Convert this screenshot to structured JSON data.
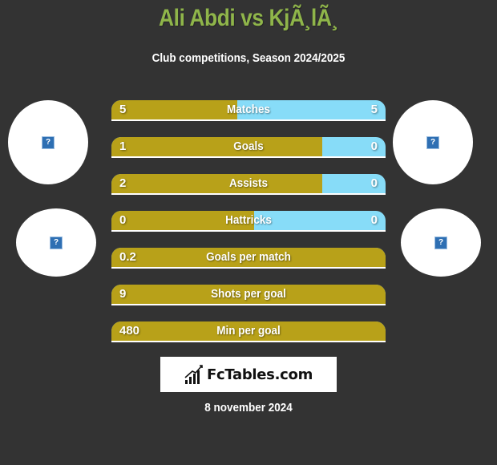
{
  "header": {
    "title": "Ali Abdi vs KjÃ¸lÃ¸",
    "subtitle": "Club competitions, Season 2024/2025"
  },
  "avatars": [
    {
      "name": "player1-photo",
      "icon": "missing-image-icon",
      "glyph": "?"
    },
    {
      "name": "player2-photo",
      "icon": "missing-image-icon",
      "glyph": "?"
    },
    {
      "name": "team1-logo",
      "icon": "missing-image-icon",
      "glyph": "?"
    },
    {
      "name": "team2-logo",
      "icon": "missing-image-icon",
      "glyph": "?"
    }
  ],
  "colors": {
    "left": "#b8a119",
    "right": "#87dcf8",
    "title": "#8fb54a",
    "background": "#333333"
  },
  "stats": [
    {
      "label": "Matches",
      "left": "5",
      "right": "5",
      "left_share": 0.46
    },
    {
      "label": "Goals",
      "left": "1",
      "right": "0",
      "left_share": 0.77
    },
    {
      "label": "Assists",
      "left": "2",
      "right": "0",
      "left_share": 0.77
    },
    {
      "label": "Hattricks",
      "left": "0",
      "right": "0",
      "left_share": 0.52
    },
    {
      "label": "Goals per match",
      "left": "0.2",
      "right": "",
      "left_share": 1.0
    },
    {
      "label": "Shots per goal",
      "left": "9",
      "right": "",
      "left_share": 1.0
    },
    {
      "label": "Min per goal",
      "left": "480",
      "right": "",
      "left_share": 1.0
    }
  ],
  "footer": {
    "brand": "FcTables.com",
    "brand_icon": "bar-chart-icon",
    "date": "8 november 2024"
  }
}
